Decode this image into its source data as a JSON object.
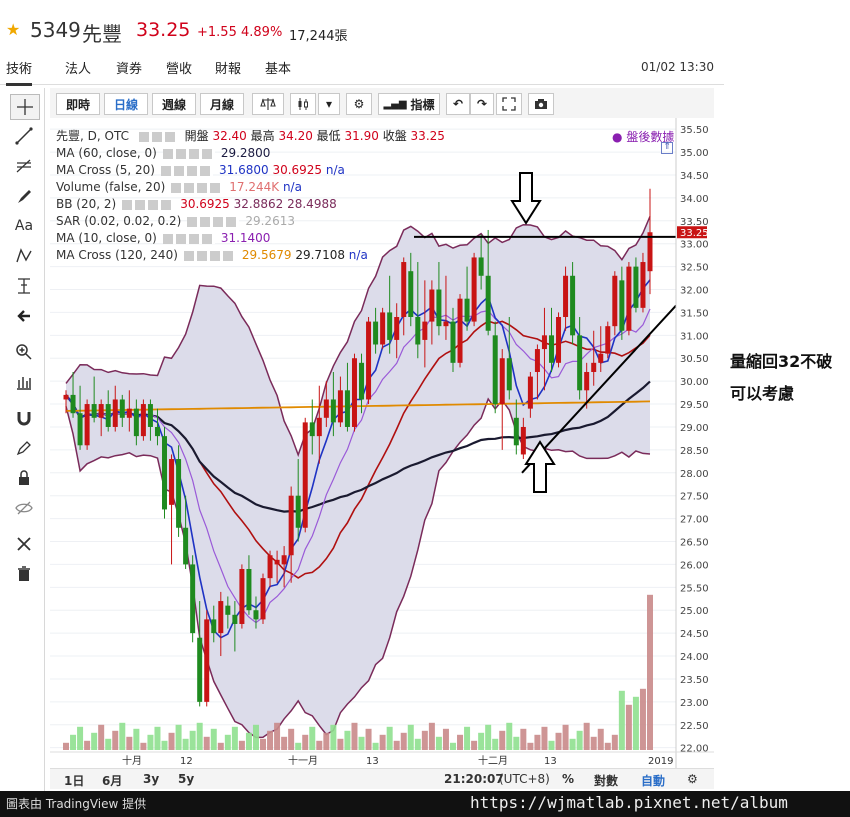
{
  "quote": {
    "code": "5349",
    "name": "先豐",
    "price": "33.25",
    "change": "+1.55",
    "percent": "4.89%",
    "volume": "17,244張"
  },
  "tabs": [
    "技術",
    "法人",
    "資券",
    "營收",
    "財報",
    "基本"
  ],
  "datetime": "01/02 13:30",
  "toolbar": {
    "intraday": "即時",
    "daily": "日線",
    "weekly": "週線",
    "monthly": "月線",
    "indicators": "指標"
  },
  "legend": {
    "main": {
      "label": "先豐, D, OTC",
      "open_lbl": "開盤",
      "open": "32.40",
      "high_lbl": "最高",
      "high": "34.20",
      "low_lbl": "最低",
      "low": "31.90",
      "close_lbl": "收盤",
      "close": "33.25",
      "right": "盤後數據"
    },
    "ma60": {
      "label": "MA (60, close, 0)",
      "v1": "29.2800"
    },
    "macross1": {
      "label": "MA Cross (5, 20)",
      "v1": "31.6800",
      "v2": "30.6925",
      "v3": "n/a"
    },
    "volume": {
      "label": "Volume (false, 20)",
      "v1": "17.244K",
      "v2": "n/a"
    },
    "bb": {
      "label": "BB (20, 2)",
      "v1": "30.6925",
      "v2": "32.8862",
      "v3": "28.4988"
    },
    "sar": {
      "label": "SAR (0.02, 0.02, 0.2)",
      "v1": "29.2613"
    },
    "ma10": {
      "label": "MA (10, close, 0)",
      "v1": "31.1400"
    },
    "macross2": {
      "label": "MA Cross (120, 240)",
      "v1": "29.5679",
      "v2": "29.7108",
      "v3": "n/a"
    }
  },
  "price_axis": [
    "35.50",
    "35.00",
    "34.50",
    "34.00",
    "33.50",
    "33.00",
    "32.50",
    "32.00",
    "31.50",
    "31.00",
    "30.50",
    "30.00",
    "29.50",
    "29.00",
    "28.50",
    "28.00",
    "27.50",
    "27.00",
    "26.50",
    "26.00",
    "25.50",
    "25.00",
    "24.50",
    "24.00",
    "23.50",
    "23.00",
    "22.50",
    "22.00"
  ],
  "price_tag": "33.25",
  "time_axis": [
    "十月",
    "12",
    "十一月",
    "13",
    "十二月",
    "13",
    "2019"
  ],
  "bottom": {
    "range1": "1日",
    "range2": "6月",
    "range3": "3y",
    "range4": "5y",
    "clock": "21:20:07",
    "tz": "(UTC+8)",
    "pct": "%",
    "log": "對數",
    "auto": "自動"
  },
  "annotation": {
    "line1": "量縮回32不破",
    "line2": "可以考慮"
  },
  "footer": {
    "credit": "圖表由 TradingView 提供",
    "url": "https://wjmatlab.pixnet.net/album"
  },
  "chart_data": {
    "type": "candlestick",
    "ylim": [
      21.6,
      35.7
    ],
    "candles": [
      [
        29.6,
        29.8,
        29.3,
        29.7
      ],
      [
        29.7,
        30.2,
        29.2,
        29.3
      ],
      [
        29.3,
        29.9,
        28.5,
        28.6
      ],
      [
        28.6,
        29.6,
        28.5,
        29.5
      ],
      [
        29.5,
        30.1,
        29.1,
        29.2
      ],
      [
        29.2,
        29.6,
        28.8,
        29.5
      ],
      [
        29.5,
        29.8,
        28.9,
        29.0
      ],
      [
        29.0,
        29.9,
        28.9,
        29.6
      ],
      [
        29.6,
        29.7,
        29.0,
        29.2
      ],
      [
        29.2,
        29.8,
        28.9,
        29.4
      ],
      [
        29.4,
        29.6,
        28.6,
        28.8
      ],
      [
        28.8,
        29.6,
        28.7,
        29.5
      ],
      [
        29.5,
        29.6,
        28.7,
        29.0
      ],
      [
        29.0,
        29.4,
        28.6,
        28.8
      ],
      [
        28.8,
        29.0,
        27.0,
        27.2
      ],
      [
        27.3,
        28.4,
        26.0,
        28.3
      ],
      [
        28.3,
        28.6,
        26.6,
        26.8
      ],
      [
        26.8,
        27.5,
        25.9,
        26.0
      ],
      [
        26.0,
        26.2,
        24.3,
        24.5
      ],
      [
        24.4,
        25.2,
        22.9,
        23.0
      ],
      [
        23.0,
        25.0,
        22.9,
        24.8
      ],
      [
        24.8,
        25.1,
        24.3,
        24.5
      ],
      [
        24.5,
        25.4,
        24.0,
        25.2
      ],
      [
        25.1,
        25.3,
        24.6,
        24.9
      ],
      [
        24.9,
        25.2,
        24.1,
        24.7
      ],
      [
        24.7,
        26.0,
        24.6,
        25.9
      ],
      [
        25.9,
        26.2,
        24.9,
        25.0
      ],
      [
        25.0,
        25.3,
        24.6,
        24.8
      ],
      [
        24.8,
        25.8,
        24.7,
        25.7
      ],
      [
        25.7,
        26.3,
        25.5,
        26.2
      ],
      [
        26.0,
        26.3,
        25.6,
        26.1
      ],
      [
        26.0,
        26.4,
        25.5,
        26.2
      ],
      [
        26.2,
        27.7,
        25.6,
        27.5
      ],
      [
        27.5,
        28.3,
        26.5,
        26.8
      ],
      [
        26.8,
        29.2,
        26.7,
        29.1
      ],
      [
        29.1,
        29.6,
        28.4,
        28.8
      ],
      [
        28.8,
        29.9,
        28.2,
        29.2
      ],
      [
        29.2,
        30.0,
        29.0,
        29.6
      ],
      [
        29.6,
        30.2,
        28.8,
        29.1
      ],
      [
        29.1,
        30.1,
        29.0,
        29.8
      ],
      [
        29.8,
        30.4,
        28.9,
        29.0
      ],
      [
        29.0,
        30.6,
        28.9,
        30.5
      ],
      [
        30.4,
        30.6,
        29.3,
        29.6
      ],
      [
        29.6,
        31.4,
        29.5,
        31.3
      ],
      [
        31.3,
        31.6,
        30.6,
        30.8
      ],
      [
        30.8,
        31.6,
        30.7,
        31.5
      ],
      [
        31.5,
        32.3,
        30.6,
        30.9
      ],
      [
        30.9,
        31.7,
        30.5,
        31.4
      ],
      [
        31.4,
        32.7,
        31.0,
        32.6
      ],
      [
        32.4,
        32.8,
        31.2,
        31.4
      ],
      [
        31.4,
        32.6,
        30.5,
        30.8
      ],
      [
        30.9,
        32.2,
        30.3,
        31.3
      ],
      [
        31.3,
        32.2,
        30.8,
        32.0
      ],
      [
        32.0,
        32.6,
        31.0,
        31.2
      ],
      [
        31.2,
        32.3,
        30.9,
        31.3
      ],
      [
        31.3,
        31.6,
        30.2,
        30.4
      ],
      [
        30.4,
        31.9,
        30.3,
        31.8
      ],
      [
        31.8,
        32.5,
        31.1,
        31.3
      ],
      [
        31.3,
        32.8,
        31.2,
        32.7
      ],
      [
        32.7,
        33.2,
        32.0,
        32.3
      ],
      [
        32.3,
        33.3,
        31.0,
        31.1
      ],
      [
        31.0,
        31.3,
        29.3,
        29.5
      ],
      [
        29.5,
        30.7,
        28.5,
        30.5
      ],
      [
        30.5,
        31.4,
        29.6,
        29.8
      ],
      [
        29.2,
        29.6,
        28.4,
        28.6
      ],
      [
        28.4,
        29.2,
        28.3,
        29.0
      ],
      [
        29.4,
        30.2,
        29.2,
        30.1
      ],
      [
        30.2,
        30.8,
        29.6,
        30.7
      ],
      [
        30.7,
        31.6,
        29.8,
        31.0
      ],
      [
        31.0,
        31.6,
        30.2,
        30.4
      ],
      [
        30.4,
        31.5,
        30.3,
        31.4
      ],
      [
        31.4,
        32.5,
        31.1,
        32.3
      ],
      [
        32.3,
        32.6,
        30.8,
        31.0
      ],
      [
        31.0,
        31.4,
        29.6,
        29.8
      ],
      [
        29.8,
        30.4,
        29.4,
        30.2
      ],
      [
        30.2,
        31.1,
        29.9,
        30.4
      ],
      [
        30.4,
        31.2,
        30.2,
        30.6
      ],
      [
        30.6,
        31.3,
        30.5,
        31.2
      ],
      [
        31.2,
        32.4,
        31.0,
        32.3
      ],
      [
        32.2,
        32.5,
        30.9,
        31.1
      ],
      [
        31.1,
        32.6,
        31.0,
        32.5
      ],
      [
        32.5,
        32.7,
        31.5,
        31.6
      ],
      [
        31.6,
        32.8,
        31.5,
        32.6
      ],
      [
        32.4,
        34.2,
        31.9,
        33.25
      ]
    ]
  }
}
